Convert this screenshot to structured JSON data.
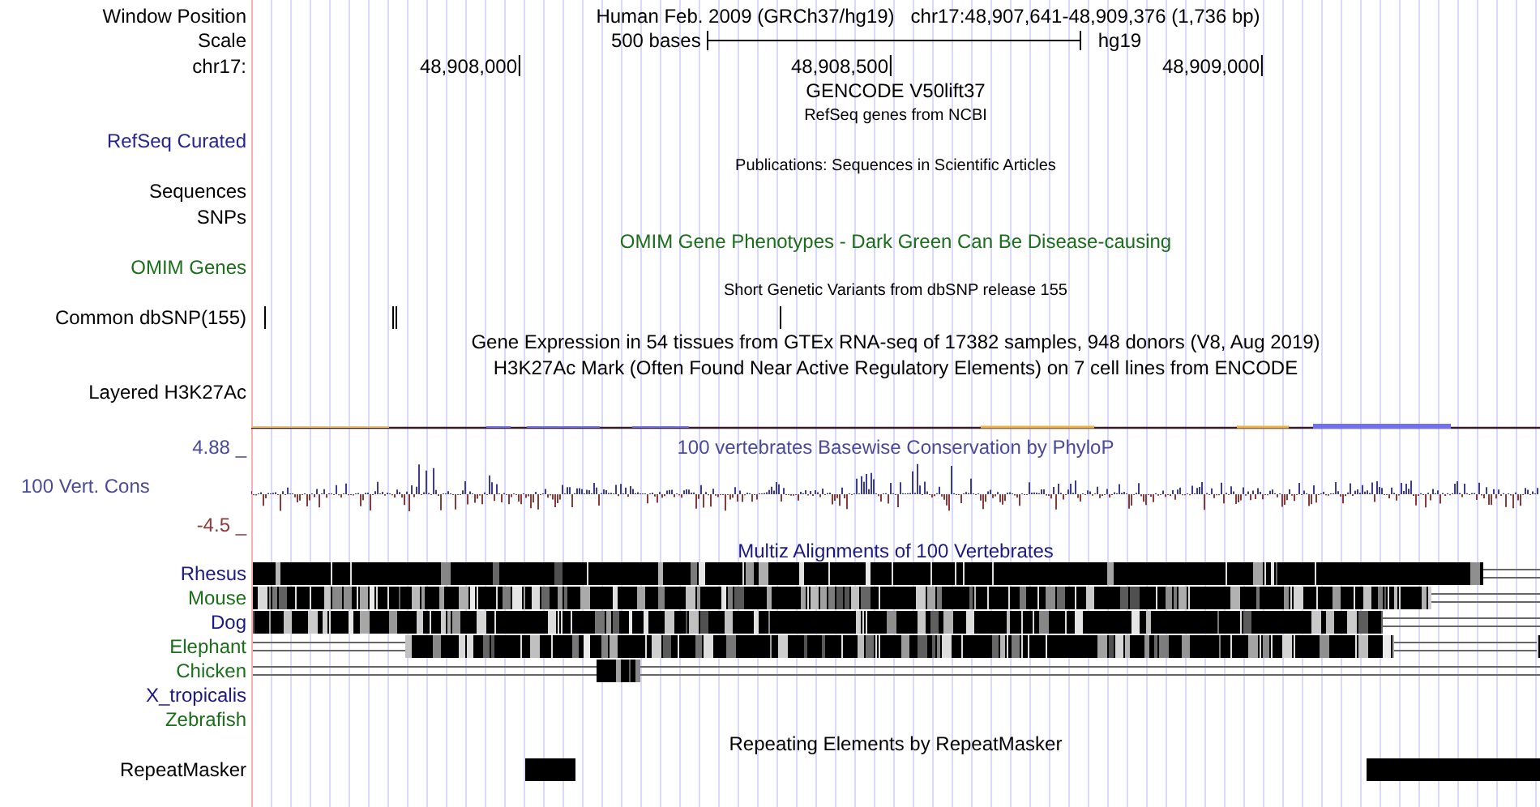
{
  "tracks": [
    {
      "kind": "position",
      "label": "Window Position",
      "assembly_title": "Human Feb. 2009 (GRCh37/hg19)",
      "position": "chr17:48,907,641-48,909,376 (1,736 bp)"
    },
    {
      "kind": "scale",
      "label": "Scale",
      "text": "500 bases",
      "assembly": "hg19"
    },
    {
      "kind": "ruler",
      "label": "chr17:",
      "ticks": [
        "48,908,000",
        "48,908,500",
        "48,909,000"
      ]
    },
    {
      "kind": "center",
      "text": "GENCODE V50lift37"
    },
    {
      "kind": "small",
      "text": "RefSeq genes from NCBI"
    },
    {
      "kind": "label",
      "label": "RefSeq Curated",
      "color": "#25258f"
    },
    {
      "kind": "small",
      "text": "Publications: Sequences in Scientific Articles"
    },
    {
      "kind": "label",
      "label": "Sequences",
      "color": "#000000"
    },
    {
      "kind": "label",
      "label": "SNPs",
      "color": "#000000"
    },
    {
      "kind": "center",
      "text": "OMIM Gene Phenotypes - Dark Green Can Be Disease-causing",
      "color": "#1a6e1a"
    },
    {
      "kind": "label",
      "label": "OMIM Genes",
      "color": "#1a6e1a"
    },
    {
      "kind": "small",
      "text": "Short Genetic Variants from dbSNP release 155"
    },
    {
      "kind": "snps",
      "label": "Common dbSNP(155)",
      "color": "#000000"
    },
    {
      "kind": "center",
      "text": "Gene Expression in 54 tissues from GTEx RNA-seq of 17382 samples, 948 donors (V8, Aug 2019)"
    },
    {
      "kind": "center",
      "text": "H3K27Ac Mark (Often Found Near Active Regulatory Elements) on 7 cell lines from ENCODE"
    },
    {
      "kind": "signal",
      "label": "Layered H3K27Ac",
      "color": "#000000"
    },
    {
      "kind": "conservation",
      "max": "4.88 _",
      "label": "100 Vert. Cons",
      "min": "-4.5 _",
      "title": "100 vertebrates Basewise Conservation by PhyloP"
    },
    {
      "kind": "multiz",
      "text": "Multiz Alignments of 100 Vertebrates",
      "color": "#1a1a80"
    },
    {
      "kind": "species",
      "label": "Rhesus",
      "color": "#1a1a80"
    },
    {
      "kind": "species",
      "label": "Mouse",
      "color": "#1a6e1a"
    },
    {
      "kind": "species",
      "label": "Dog",
      "color": "#1a1a80"
    },
    {
      "kind": "species",
      "label": "Elephant",
      "color": "#1a6e1a"
    },
    {
      "kind": "species",
      "label": "Chicken",
      "color": "#1a6e1a"
    },
    {
      "kind": "species",
      "label": "X_tropicalis",
      "color": "#1a1a80"
    },
    {
      "kind": "species",
      "label": "Zebrafish",
      "color": "#1a6e1a"
    },
    {
      "kind": "center",
      "text": "Repeating Elements by RepeatMasker"
    },
    {
      "kind": "repeats",
      "label": "RepeatMasker",
      "color": "#000000"
    }
  ]
}
